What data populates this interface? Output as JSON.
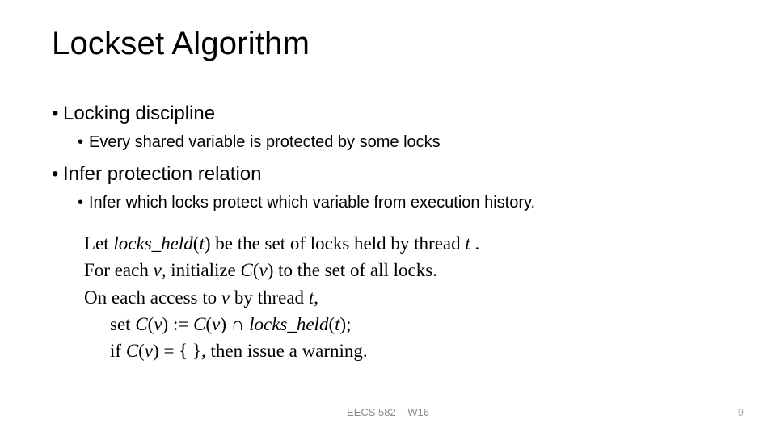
{
  "title": "Lockset Algorithm",
  "bullets": {
    "b1": "Locking discipline",
    "b1a": "Every shared variable is protected by some locks",
    "b2": "Infer protection relation",
    "b2a": "Infer which locks protect which variable from execution history."
  },
  "algorithm": {
    "line1_a": "Let ",
    "line1_b": "locks_held",
    "line1_c": "(",
    "line1_d": "t",
    "line1_e": ") be the set of locks held by thread ",
    "line1_f": "t",
    "line1_g": " .",
    "line2_a": "For each ",
    "line2_b": "v",
    "line2_c": ", initialize ",
    "line2_d": "C",
    "line2_e": "(",
    "line2_f": "v",
    "line2_g": ") to the set of all locks.",
    "line3_a": "On each access to ",
    "line3_b": "v",
    "line3_c": " by thread ",
    "line3_d": "t",
    "line3_e": ",",
    "line4_a": "set ",
    "line4_b": "C",
    "line4_c": "(",
    "line4_d": "v",
    "line4_e": ") := ",
    "line4_f": "C",
    "line4_g": "(",
    "line4_h": "v",
    "line4_i": ") ∩ ",
    "line4_j": "locks_held",
    "line4_k": "(",
    "line4_l": "t",
    "line4_m": ");",
    "line5_a": "if ",
    "line5_b": "C",
    "line5_c": "(",
    "line5_d": "v",
    "line5_e": ") = { }, then issue a warning."
  },
  "footer": {
    "center": "EECS 582 – W16",
    "page": "9"
  }
}
